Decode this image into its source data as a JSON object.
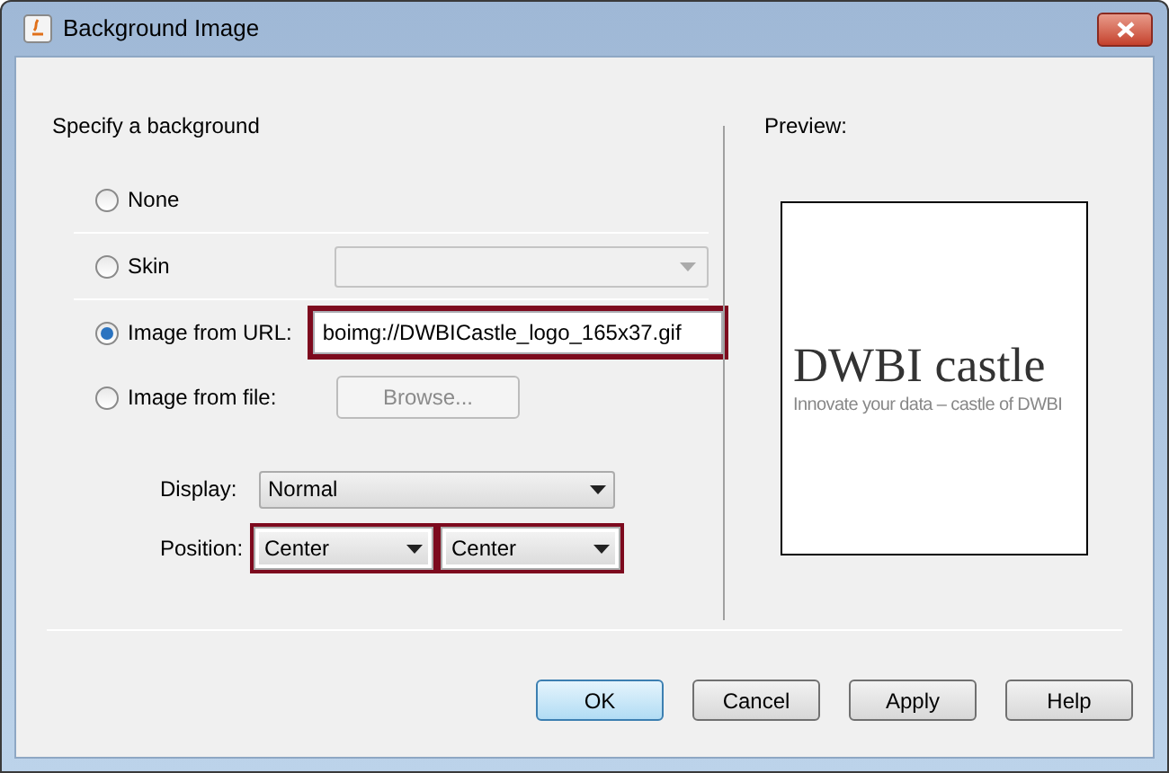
{
  "window": {
    "title": "Background Image"
  },
  "section_title": "Specify a background",
  "sources": [
    {
      "kind": "none",
      "label": "None",
      "selected": false
    },
    {
      "kind": "skin",
      "label": "Skin",
      "selected": false
    },
    {
      "kind": "url",
      "label": "Image from URL:",
      "selected": true,
      "value": "boimg://DWBICastle_logo_165x37.gif",
      "highlighted": true
    },
    {
      "kind": "file",
      "label": "Image from file:",
      "selected": false,
      "button": "Browse..."
    }
  ],
  "display": {
    "label": "Display:",
    "value": "Normal"
  },
  "position": {
    "label": "Position:",
    "combos": [
      {
        "value": "Center",
        "highlighted": true
      },
      {
        "value": "Center",
        "highlighted": true
      }
    ]
  },
  "preview": {
    "label": "Preview:",
    "logo_title": "DWBI castle",
    "logo_tagline": "Innovate your data – castle of DWBI"
  },
  "buttons": [
    {
      "label": "OK",
      "default": true
    },
    {
      "label": "Cancel",
      "default": false
    },
    {
      "label": "Apply",
      "default": false
    },
    {
      "label": "Help",
      "default": false
    }
  ]
}
